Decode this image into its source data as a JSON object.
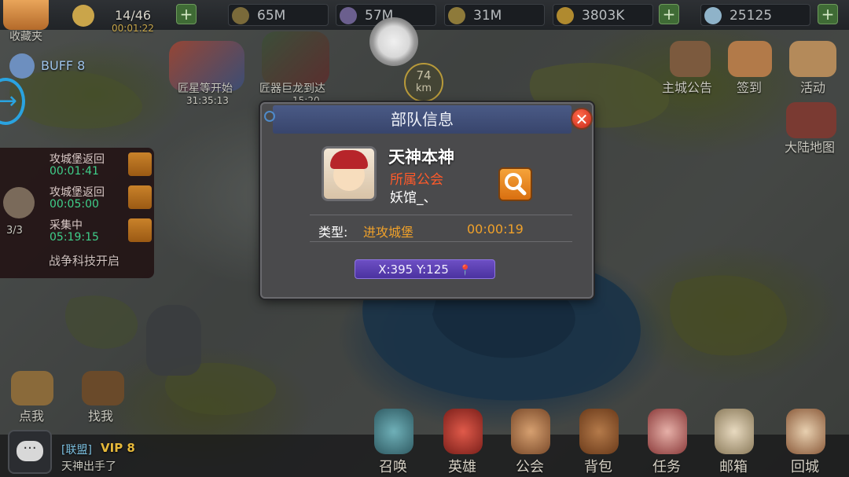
{
  "status": {
    "units": "14/46",
    "timer": "00:01:22",
    "collect_label": "收藏夹"
  },
  "resources": {
    "food": "65M",
    "stone": "57M",
    "wood": "31M",
    "gold": "3803K",
    "diamond": "25125"
  },
  "buff": {
    "label": "BUFF 8"
  },
  "events": [
    {
      "label": "匠星等开始",
      "time": "31:35:13"
    },
    {
      "label": "匠器巨龙到达",
      "time": "15:20"
    }
  ],
  "distance": {
    "value": "74",
    "unit": "km"
  },
  "right_menu": {
    "announce": "主城公告",
    "signin": "签到",
    "activity": "活动",
    "world_map": "大陆地图"
  },
  "queue": {
    "count": "3/3",
    "items": [
      {
        "name": "攻城堡返回",
        "time": "00:01:41"
      },
      {
        "name": "攻城堡返回",
        "time": "00:05:00"
      },
      {
        "name": "采集中",
        "time": "05:19:15"
      }
    ],
    "tech_label": "战争科技开启"
  },
  "dialog": {
    "title": "部队信息",
    "player_name": "天神本神",
    "guild_label": "所属公会",
    "guild_name": "妖馆_、",
    "type_label": "类型:",
    "type_value": "进攻城堡",
    "time": "00:00:19",
    "coords": "X:395  Y:125"
  },
  "left_actions": {
    "click_me": "点我",
    "find_me": "找我"
  },
  "chat": {
    "tag": "[联盟]",
    "vip": "VIP 8",
    "message": "天神出手了"
  },
  "bottom_nav": [
    "召唤",
    "英雄",
    "公会",
    "背包",
    "任务",
    "邮箱",
    "回城"
  ],
  "colors": {
    "accent_orange": "#e8891d",
    "dialog_header": "#3d4a72",
    "coord_button": "#5a3fb4",
    "timer_green": "#3fcf8a",
    "guild_red": "#ff5a2a"
  }
}
